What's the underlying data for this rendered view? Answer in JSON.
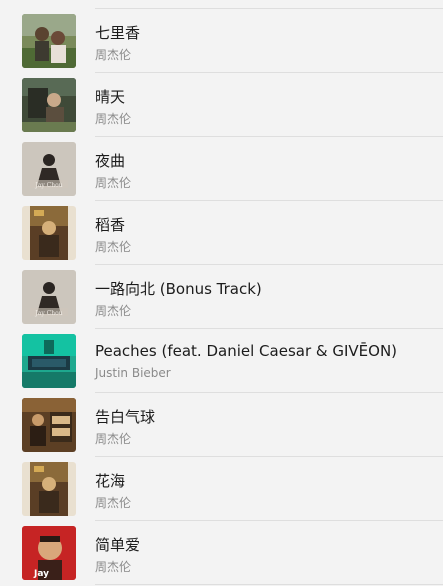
{
  "songs": [
    {
      "title": "七里香",
      "artist": "周杰伦",
      "cover": "qilixiang-cover"
    },
    {
      "title": "晴天",
      "artist": "周杰伦",
      "cover": "yeqingjieru-cover"
    },
    {
      "title": "夜曲",
      "artist": "周杰伦",
      "cover": "jay-chou-cover"
    },
    {
      "title": "稻香",
      "artist": "周杰伦",
      "cover": "mojiezuo-cover"
    },
    {
      "title": "一路向北 (Bonus Track)",
      "artist": "周杰伦",
      "cover": "jay-chou-cover"
    },
    {
      "title": "Peaches (feat. Daniel Caesar & GIVĒON)",
      "artist": "Justin Bieber",
      "cover": "justice-cover"
    },
    {
      "title": "告白气球",
      "artist": "周杰伦",
      "cover": "bedtime-stories-cover"
    },
    {
      "title": "花海",
      "artist": "周杰伦",
      "cover": "mojiezuo-cover"
    },
    {
      "title": "简单爱",
      "artist": "周杰伦",
      "cover": "jay-cover"
    }
  ]
}
